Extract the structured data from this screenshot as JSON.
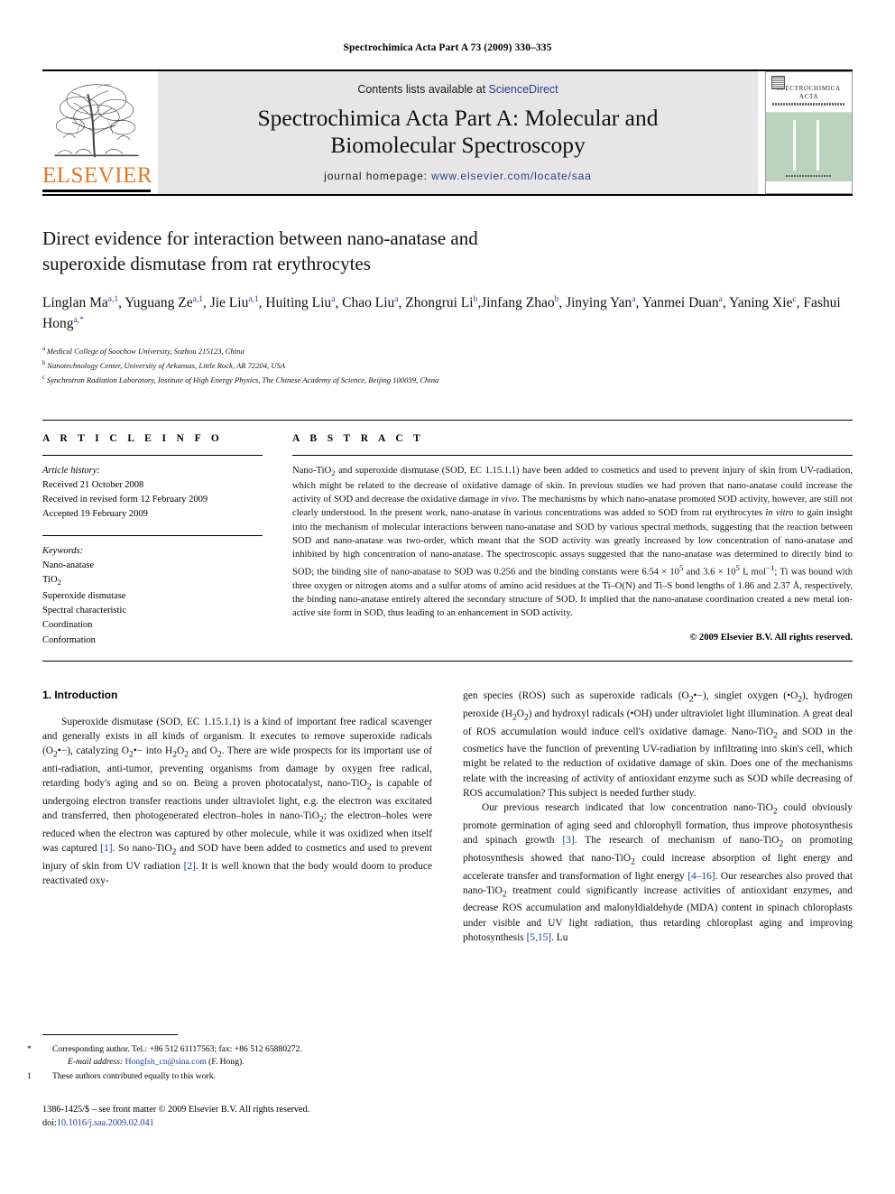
{
  "running_head": "Spectrochimica Acta Part A 73 (2009) 330–335",
  "masthead": {
    "contents_prefix": "Contents lists available at ",
    "sciencedirect": "ScienceDirect",
    "journal_title_line1": "Spectrochimica Acta Part A: Molecular and",
    "journal_title_line2": "Biomolecular Spectroscopy",
    "homepage_prefix": "journal homepage:",
    "homepage_url": "www.elsevier.com/locate/saa",
    "publisher": "ELSEVIER",
    "cover_title_line1": "SPECTROCHIMICA",
    "cover_title_line2": "ACTA",
    "accent_orange": "#E87722",
    "link_blue": "#2a3b8f",
    "band_gray": "#e6e6e6",
    "cover_green": "#b9d3bc"
  },
  "article": {
    "title_line1": "Direct evidence for interaction between nano-anatase and",
    "title_line2": "superoxide dismutase from rat erythrocytes",
    "authors_line1": "Linglan Ma, Yuguang Ze, Jie Liu, Huiting Liu, Chao Liu, Zhongrui Li,",
    "authors_line2": "Jinfang Zhao, Jinying Yan, Yanmei Duan, Yaning Xie, Fashui Hong",
    "authors": [
      {
        "name": "Linglan Ma",
        "marks": "a,1",
        "sep": ", "
      },
      {
        "name": "Yuguang Ze",
        "marks": "a,1",
        "sep": ", "
      },
      {
        "name": "Jie Liu",
        "marks": "a,1",
        "sep": ", "
      },
      {
        "name": "Huiting Liu",
        "marks": "a",
        "sep": ", "
      },
      {
        "name": "Chao Liu",
        "marks": "a",
        "sep": ", "
      },
      {
        "name": "Zhongrui Li",
        "marks": "b",
        "sep": ","
      },
      {
        "name": "Jinfang Zhao",
        "marks": "b",
        "sep": ", "
      },
      {
        "name": "Jinying Yan",
        "marks": "a",
        "sep": ", "
      },
      {
        "name": "Yanmei Duan",
        "marks": "a",
        "sep": ", "
      },
      {
        "name": "Yaning Xie",
        "marks": "c",
        "sep": ", "
      },
      {
        "name": "Fashui Hong",
        "marks": "a,*",
        "sep": ""
      }
    ],
    "affiliations": [
      {
        "mark": "a",
        "text": "Medical College of Soochow University, Suzhou 215123, China"
      },
      {
        "mark": "b",
        "text": "Nanotechnology Center, University of Arkansas, Little Rock, AR 72204, USA"
      },
      {
        "mark": "c",
        "text": "Synchrotron Radiation Laboratory, Institute of High Energy Physics, The Chinese Academy of Science, Beijing 100039, China"
      }
    ]
  },
  "article_info": {
    "heading": "A R T I C L E  I N F O",
    "history_label": "Article history:",
    "history": [
      "Received 21 October 2008",
      "Received in revised form 12 February 2009",
      "Accepted 19 February 2009"
    ],
    "keywords_label": "Keywords:",
    "keywords": [
      "Nano-anatase",
      "TiO2",
      "Superoxide dismutase",
      "Spectral characteristic",
      "Coordination",
      "Conformation"
    ]
  },
  "abstract": {
    "heading": "A B S T R A C T",
    "text": "Nano-TiO2 and superoxide dismutase (SOD, EC 1.15.1.1) have been added to cosmetics and used to prevent injury of skin from UV-radiation, which might be related to the decrease of oxidative damage of skin. In previous studies we had proven that nano-anatase could increase the activity of SOD and decrease the oxidative damage in vivo. The mechanisms by which nano-anatase promoted SOD activity, however, are still not clearly understood. In the present work, nano-anatase in various concentrations was added to SOD from rat erythrocytes in vitro to gain insight into the mechanism of molecular interactions between nano-anatase and SOD by various spectral methods, suggesting that the reaction between SOD and nano-anatase was two-order, which meant that the SOD activity was greatly increased by low concentration of nano-anatase and inhibited by high concentration of nano-anatase. The spectroscopic assays suggested that the nano-anatase was determined to directly bind to SOD; the binding site of nano-anatase to SOD was 0.256 and the binding constants were 6.54 × 10^5 and 3.6 × 10^5 L mol−1; Ti was bound with three oxygen or nitrogen atoms and a sulfur atoms of amino acid residues at the Ti–O(N) and Ti–S bond lengths of 1.86 and 2.37 Å, respectively, the binding nano-anatase entirely altered the secondary structure of SOD. It implied that the nano-anatase coordination created a new metal ion-active site form in SOD, thus leading to an enhancement in SOD activity.",
    "copyright": "© 2009 Elsevier B.V. All rights reserved."
  },
  "introduction": {
    "heading": "1.  Introduction",
    "para1": "Superoxide dismutase (SOD, EC 1.15.1.1) is a kind of important free radical scavenger and generally exists in all kinds of organism. It executes to remove superoxide radicals (O2•−), catalyzing O2•− into H2O2 and O2. There are wide prospects for its important use of anti-radiation, anti-tumor, preventing organisms from damage by oxygen free radical, retarding body's aging and so on. Being a proven photocatalyst, nano-TiO2 is capable of undergoing electron transfer reactions under ultraviolet light, e.g. the electron was excitated and transferred, then photogenerated electron–holes in nano-TiO2; the electron–holes were reduced when the electron was captured by other molecule, while it was oxidized when itself was captured [1]. So nano-TiO2 and SOD have been added to cosmetics and used to prevent injury of skin from UV radiation [2]. It is well known that the body would doom to produce reactivated oxy-",
    "para2": "gen species (ROS) such as superoxide radicals (O2•−), singlet oxygen (•O2), hydrogen peroxide (H2O2) and hydroxyl radicals (•OH) under ultraviolet light illumination. A great deal of ROS accumulation would induce cell's oxidative damage. Nano-TiO2 and SOD in the cosmetics have the function of preventing UV-radiation by infiltrating into skin's cell, which might be related to the reduction of oxidative damage of skin. Does one of the mechanisms relate with the increasing of activity of antioxidant enzyme such as SOD while decreasing of ROS accumulation? This subject is needed further study.",
    "para3": "Our previous research indicated that low concentration nano-TiO2 could obviously promote germination of aging seed and chlorophyll formation, thus improve photosynthesis and spinach growth [3]. The research of mechanism of nano-TiO2 on promoting photosynthesis showed that nano-TiO2 could increase absorption of light energy and accelerate transfer and transformation of light energy [4–16]. Our researches also proved that nano-TiO2 treatment could significantly increase activities of antioxidant enzymes, and decrease ROS accumulation and malonyldialdehyde (MDA) content in spinach chloroplasts under visible and UV light radiation, thus retarding chloroplast aging and improving photosynthesis [5,15]. Lu"
  },
  "footnotes": {
    "corresponding": "Corresponding author. Tel.: +86 512 61117563; fax: +86 512 65880272.",
    "email_label": "E-mail address:",
    "email": "Hongfsh_cn@sina.com",
    "email_suffix": "(F. Hong).",
    "equal_contribution": "These authors contributed equally to this work.",
    "mark_star": "*",
    "mark_one": "1"
  },
  "footer": {
    "issn_line": "1386-1425/$ – see front matter © 2009 Elsevier B.V. All rights reserved.",
    "doi_prefix": "doi:",
    "doi": "10.1016/j.saa.2009.02.041"
  }
}
